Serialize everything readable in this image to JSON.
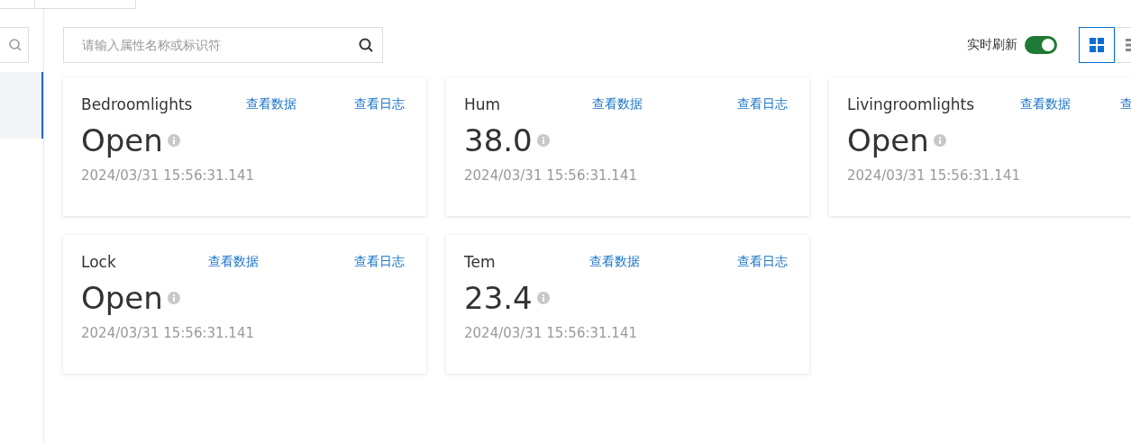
{
  "sidebar": {
    "items": [
      {
        "selected": true
      }
    ]
  },
  "search": {
    "placeholder": "请输入属性名称或标识符"
  },
  "realtime_refresh": {
    "label": "实时刷新",
    "on": true
  },
  "view_modes": [
    {
      "kind": "grid",
      "selected": true
    },
    {
      "kind": "list",
      "selected": false
    }
  ],
  "properties": [
    {
      "name": "Bedroomlights",
      "value": "Open",
      "timestamp": "2024/03/31 15:56:31.141",
      "links": [
        "查看数据",
        "查看日志"
      ]
    },
    {
      "name": "Hum",
      "value": "38.0",
      "timestamp": "2024/03/31 15:56:31.141",
      "links": [
        "查看数据",
        "查看日志"
      ]
    },
    {
      "name": "Livingroomlights",
      "value": "Open",
      "timestamp": "2024/03/31 15:56:31.141",
      "links": [
        "查看数据",
        "查"
      ]
    },
    {
      "name": "Lock",
      "value": "Open",
      "timestamp": "2024/03/31 15:56:31.141",
      "links": [
        "查看数据",
        "查看日志"
      ]
    },
    {
      "name": "Tem",
      "value": "23.4",
      "timestamp": "2024/03/31 15:56:31.141",
      "links": [
        "查看数据",
        "查看日志"
      ]
    }
  ]
}
